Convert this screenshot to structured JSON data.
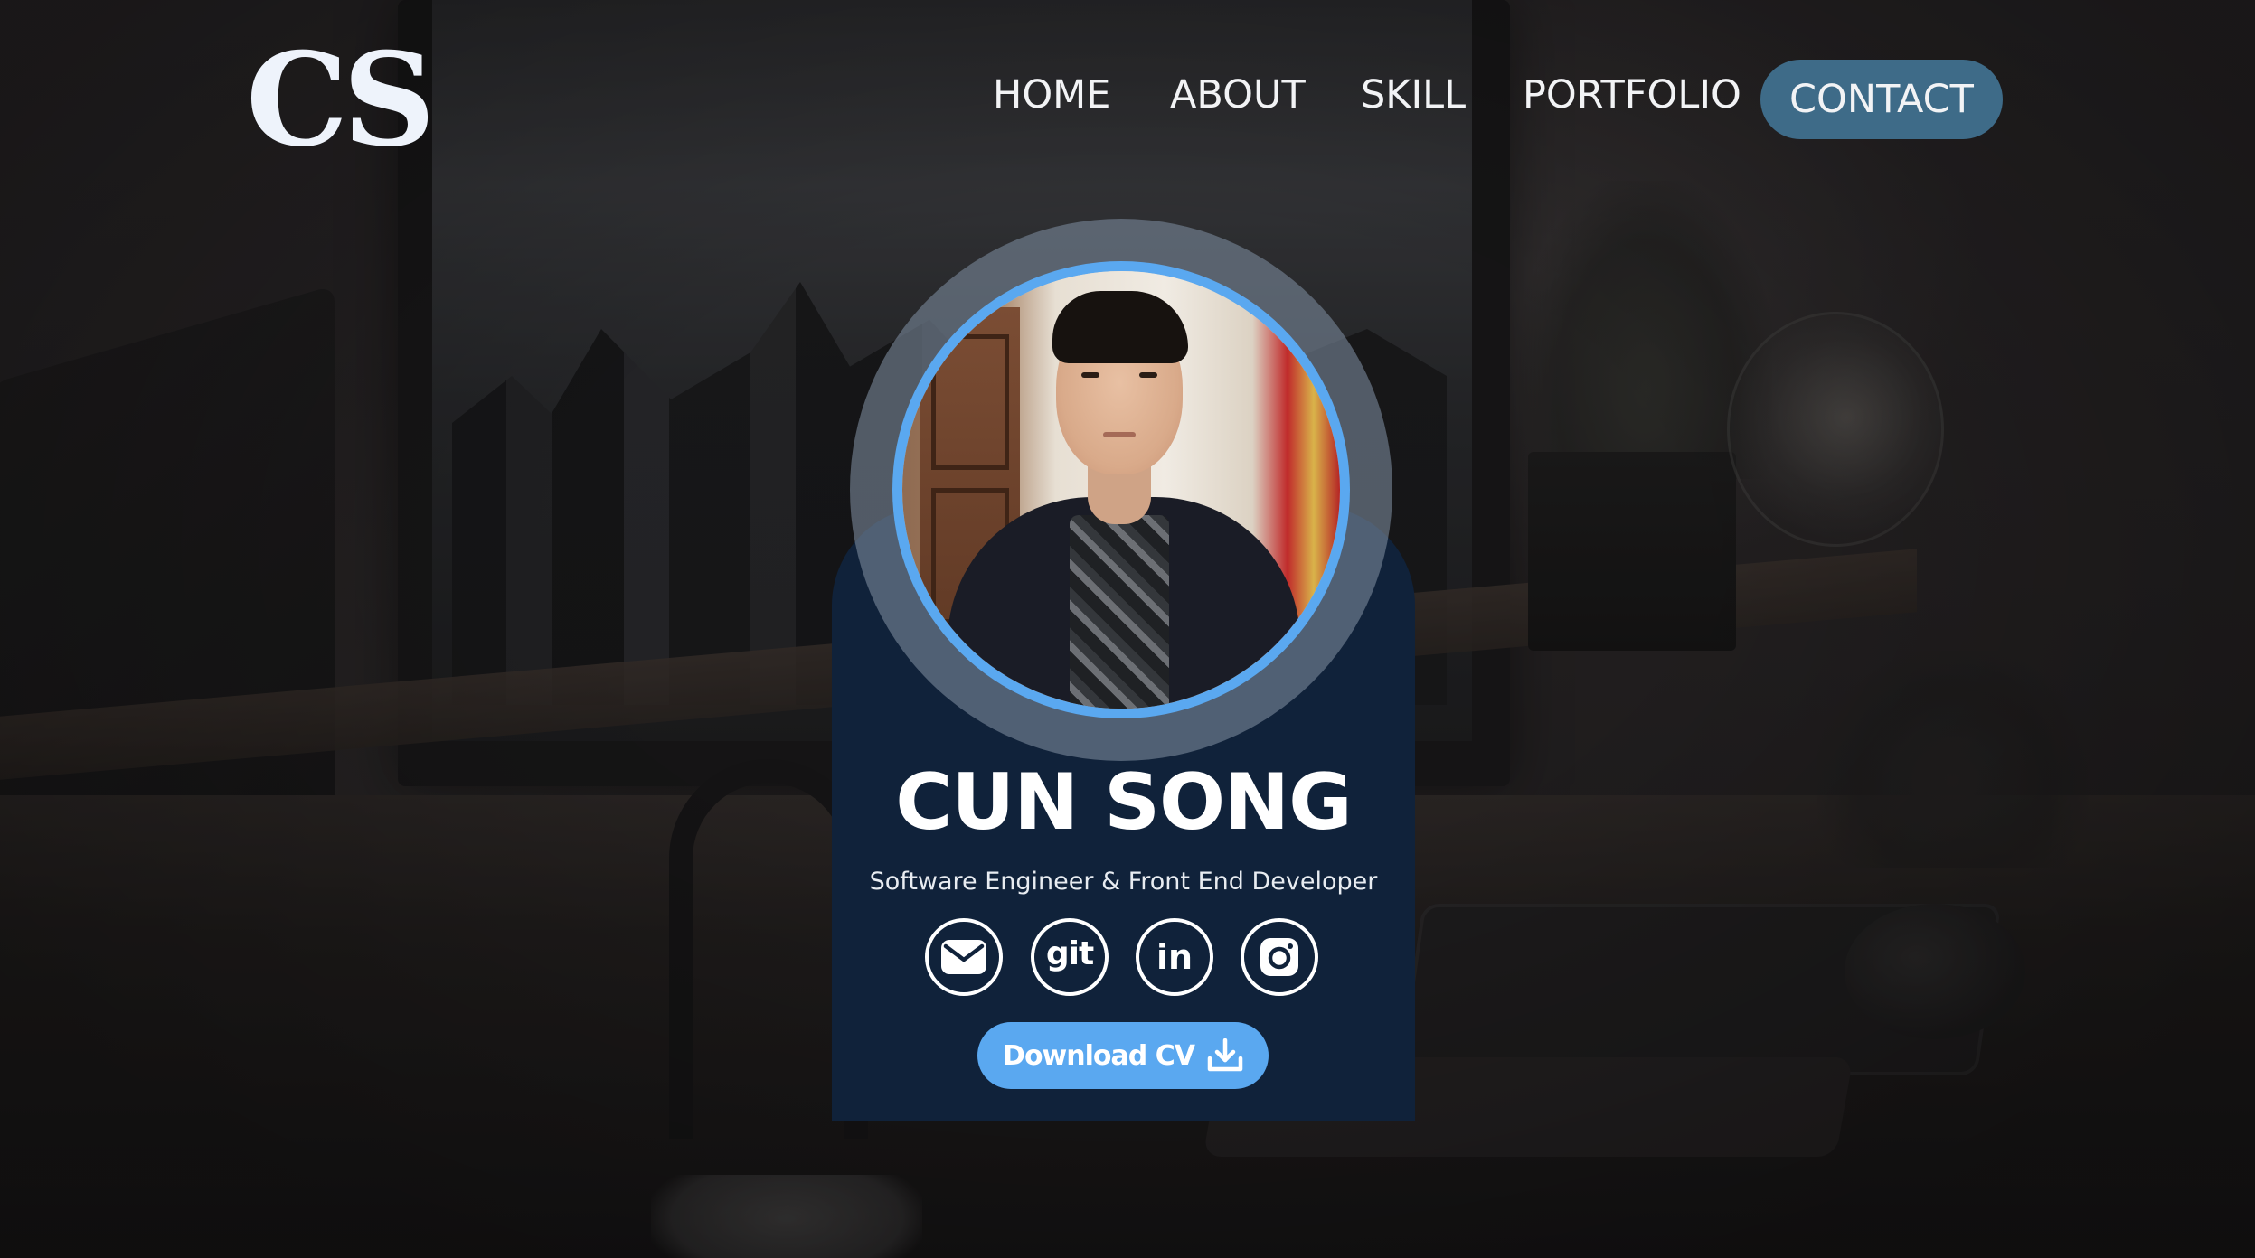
{
  "logo": {
    "text": "CS"
  },
  "nav": {
    "items": [
      {
        "label": "HOME"
      },
      {
        "label": "ABOUT"
      },
      {
        "label": "SKILL"
      },
      {
        "label": "PORTFOLIO"
      }
    ],
    "cta": {
      "label": "CONTACT"
    }
  },
  "profile": {
    "name": "CUN SONG",
    "role": "Software Engineer & Front End Developer",
    "socials": [
      {
        "icon": "mail-icon"
      },
      {
        "icon": "git-icon",
        "text": "git"
      },
      {
        "icon": "linkedin-icon",
        "text": "in"
      },
      {
        "icon": "instagram-icon"
      }
    ],
    "download": {
      "label": "Download CV",
      "icon": "download-icon"
    }
  },
  "colors": {
    "accent": "#5aa8f0",
    "card": "#10223a",
    "contact_button": "#3e6b88",
    "logo": "#eef3fb"
  }
}
